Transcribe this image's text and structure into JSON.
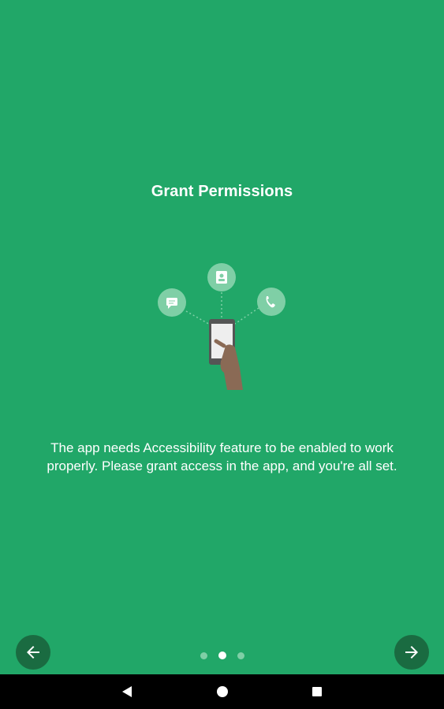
{
  "onboarding": {
    "title": "Grant Permissions",
    "description": "The app needs Accessibility feature to be enabled to work properly. Please grant access in the app, and you're all set.",
    "page_indicator": {
      "total": 3,
      "current": 2
    },
    "prev_icon": "arrow-left-icon",
    "next_icon": "arrow-right-icon"
  },
  "illustration": {
    "icons": [
      "message-icon",
      "contact-icon",
      "phone-icon"
    ],
    "center": "hand-holding-phone-icon"
  },
  "system_nav": {
    "back_icon": "back-triangle-icon",
    "home_icon": "home-circle-icon",
    "recents_icon": "recents-square-icon"
  },
  "colors": {
    "background": "#21a768",
    "nav_button": "#1a6b41",
    "dot_inactive": "#7fcfa6",
    "dot_active": "#ffffff",
    "system_bar": "#000000"
  }
}
